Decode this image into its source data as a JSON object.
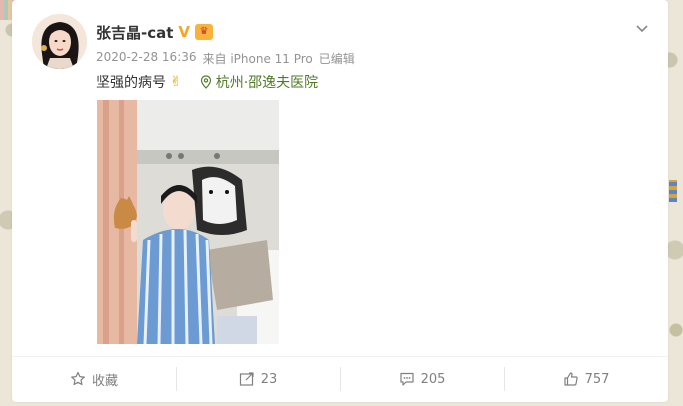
{
  "post": {
    "username": "张吉晶-cat",
    "verified_badge": "V",
    "member_icon": "crown-icon",
    "meta": {
      "timestamp": "2020-2-28 16:36",
      "source": "来自 iPhone 11 Pro",
      "edited": "已编辑"
    },
    "text": "坚强的病号",
    "emoji": "✌",
    "location": "杭州·邵逸夫医院"
  },
  "actions": {
    "favorite_label": "收藏",
    "repost_count": "23",
    "comment_count": "205",
    "like_count": "757"
  },
  "colors": {
    "accent_verified": "#f5a623",
    "location_green": "#507a2a",
    "muted_text": "#939393"
  }
}
